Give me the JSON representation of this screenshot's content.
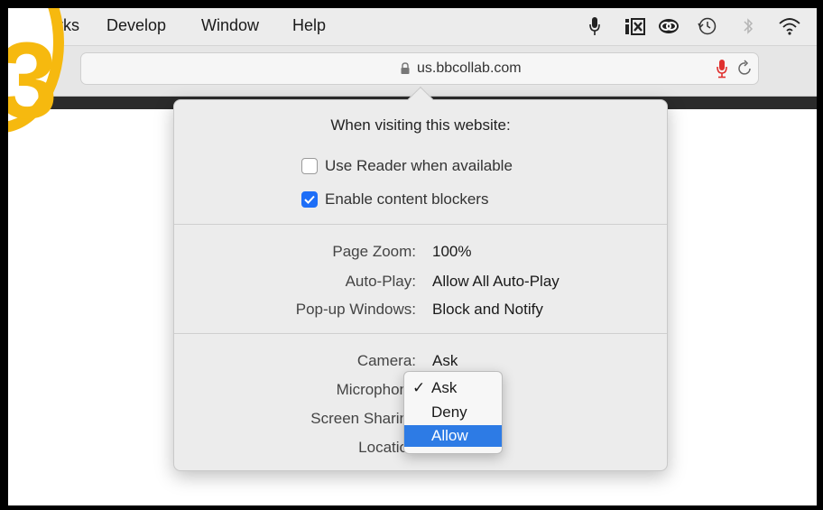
{
  "menubar": {
    "items": [
      "marks",
      "Develop",
      "Window",
      "Help"
    ]
  },
  "address": {
    "url": "us.bbcollab.com"
  },
  "badge": {
    "number": "3"
  },
  "popover": {
    "title": "When visiting this website:",
    "checkboxes": [
      {
        "label": "Use Reader when available",
        "checked": false
      },
      {
        "label": "Enable content blockers",
        "checked": true
      }
    ],
    "settings": [
      {
        "label": "Page Zoom:",
        "value": "100%"
      },
      {
        "label": "Auto-Play:",
        "value": "Allow All Auto-Play"
      },
      {
        "label": "Pop-up Windows:",
        "value": "Block and Notify"
      }
    ],
    "permissions": [
      {
        "label": "Camera:",
        "value": "Ask"
      },
      {
        "label": "Microphon",
        "value": ""
      },
      {
        "label": "Screen Sharin",
        "value": ""
      },
      {
        "label": "Locatio",
        "value": ""
      }
    ]
  },
  "dropdown": {
    "check": "✓",
    "options": [
      {
        "label": "Ask",
        "checked": true,
        "highlighted": false
      },
      {
        "label": "Deny",
        "checked": false,
        "highlighted": false
      },
      {
        "label": "Allow",
        "checked": false,
        "highlighted": true
      }
    ]
  },
  "colors": {
    "badge": "#f6b90f",
    "accent": "#2d7be5",
    "mic": "#e0302e"
  }
}
